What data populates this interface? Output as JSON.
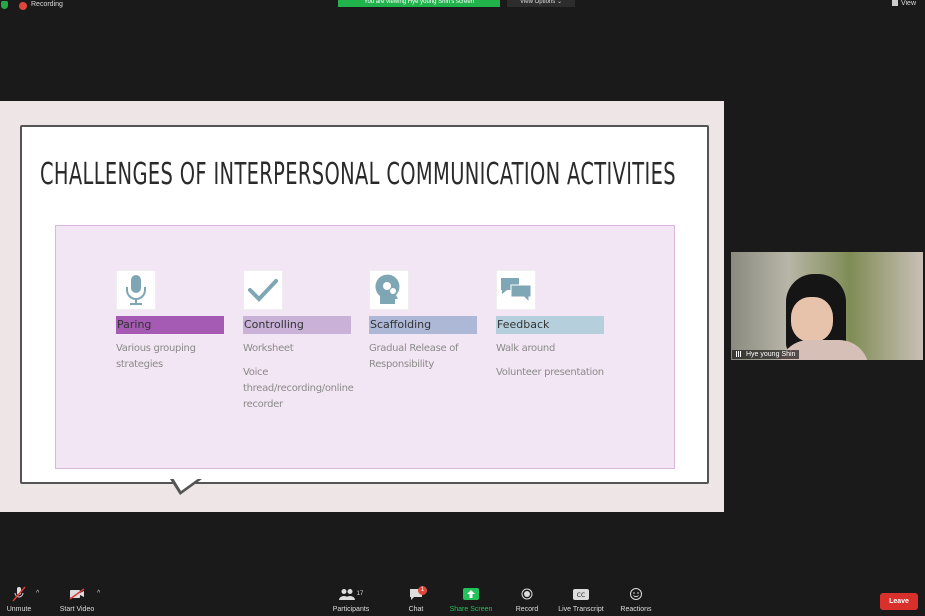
{
  "status": {
    "recording_label": "Recording",
    "viewing_banner": "You are viewing Hye young Shin's screen",
    "view_options_label": "View Options ⌄",
    "view_label": "View"
  },
  "slide": {
    "title": "CHALLENGES OF INTERPERSONAL COMMUNICATION ACTIVITIES",
    "columns": [
      {
        "icon": "microphone-icon",
        "label": "Paring",
        "label_color": "#a55bb3",
        "items": [
          "Various grouping strategies"
        ]
      },
      {
        "icon": "checkmark-icon",
        "label": "Controlling",
        "label_color": "#c9b1d8",
        "items": [
          "Worksheet",
          "Voice thread/recording/online recorder"
        ]
      },
      {
        "icon": "head-gears-icon",
        "label": "Scaffolding",
        "label_color": "#adb7d6",
        "items": [
          "Gradual Release of Responsibility"
        ]
      },
      {
        "icon": "chat-bubbles-icon",
        "label": "Feedback",
        "label_color": "#b5d0dc",
        "items": [
          "Walk around",
          "Volunteer presentation"
        ]
      }
    ]
  },
  "participant": {
    "name": "Hye young Shin"
  },
  "toolbar": {
    "unmute_label": "Unmute",
    "start_video_label": "Start Video",
    "participants_label": "Participants",
    "participants_count": "17",
    "chat_label": "Chat",
    "chat_badge": "1",
    "share_screen_label": "Share Screen",
    "record_label": "Record",
    "live_transcript_label": "Live Transcript",
    "reactions_label": "Reactions",
    "leave_label": "Leave"
  }
}
